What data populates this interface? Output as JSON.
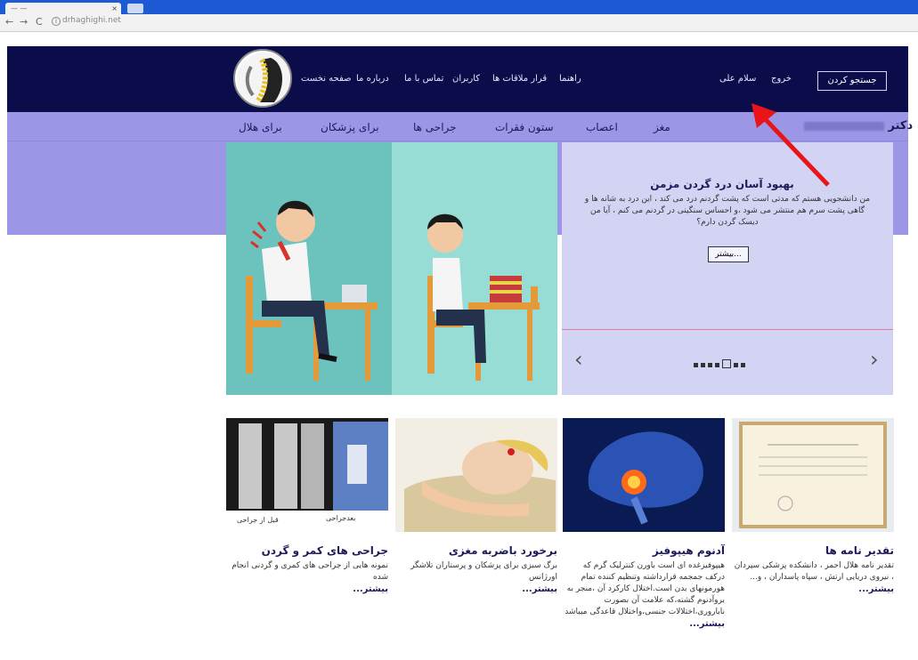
{
  "browser": {
    "tab_title": "— —",
    "tab_close": "×",
    "nav": {
      "back": "←",
      "forward": "→",
      "reload": "C"
    },
    "url": "drhaghighi.net"
  },
  "header": {
    "links": [
      "صفحه نخست",
      "درباره ما",
      "تماس با ما",
      "کاربران",
      "قرار ملاقات ها",
      "راهنما"
    ],
    "greeting": "سلام علی",
    "logout": "خروج",
    "search": "جستجو کردن"
  },
  "subnav": {
    "doctor_prefix": "دکتر",
    "links": [
      "برای هلال",
      "برای پزشکان",
      "جراحی ها",
      "ستون فقرات",
      "اعصاب",
      "مغز"
    ]
  },
  "slider": {
    "title": "بهبود آسان درد گردن مزمن",
    "text": "من دانشجویی هستم که مدتی است که پشت گردنم درد می کند ، این درد به شانه ها و گاهی پشت سرم هم منتشر می شود ،و احساس سنگینی در گردنم می کنم ، آیا من دیسک گردن دارم؟",
    "more": "بیشتر...",
    "prev": "‹",
    "next": "›"
  },
  "cards": [
    {
      "title": "تقدیر نامه ها",
      "text": "تقدیر نامه هلال احمر ، دانشکده پزشکی سپردان ، نیروی دریایی ارتش ، سپاه پاسداران ، و...",
      "more": "بیشتر..."
    },
    {
      "title": "آدنوم هیپوفیز",
      "text": "هیپوفیزغده ای است باورن کنترلیک گرم که درکف جمجمه قرارداشته وتنظیم کننده تمام هورمونهای بدن است.اختلال کارکرد آن ،منجر به بروآدنوم گشته،که علامت آن بصورت ناباروری،اختلالات جنسی،واختلال قاعدگی میباشد",
      "more": "بیشتر..."
    },
    {
      "title": "برخورد باضربه مغزی",
      "text": "برگ سبزی برای پزشکان و پرستاران تلاشگر اورژانس",
      "more": "بیشتر..."
    },
    {
      "title": "جراحی های کمر و گردن",
      "text": "نمونه هایی از جراحی های کمری و گردنی انجام شده",
      "more": "بیشتر...",
      "caption_before": "قبل از جراحی",
      "caption_after": "بعدجراحی"
    }
  ]
}
